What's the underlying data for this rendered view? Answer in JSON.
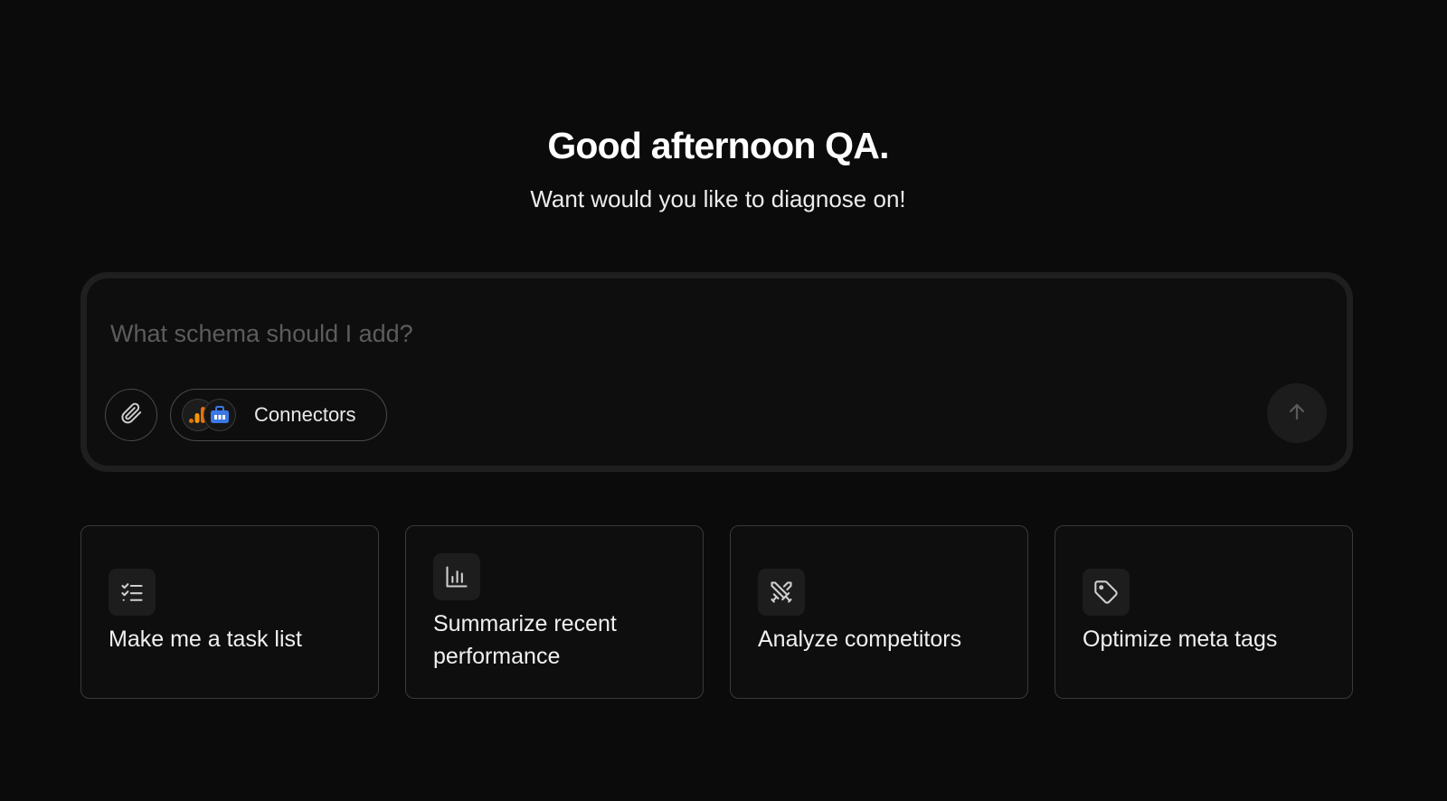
{
  "header": {
    "greeting": "Good afternoon QA.",
    "subtitle": "Want would you like to diagnose on!"
  },
  "composer": {
    "placeholder": "What schema should I add?",
    "value": "",
    "attach_icon": "paperclip-icon",
    "connectors_label": "Connectors",
    "connector_icons": [
      "analytics-chart-icon",
      "briefcase-icon"
    ],
    "send_icon": "arrow-up-icon"
  },
  "cards": [
    {
      "label": "Make me a task list",
      "icon": "checklist-icon"
    },
    {
      "label": "Summarize recent performance",
      "icon": "bar-chart-icon"
    },
    {
      "label": "Analyze competitors",
      "icon": "crossed-swords-icon"
    },
    {
      "label": "Optimize meta tags",
      "icon": "tag-icon"
    }
  ],
  "colors": {
    "background": "#0b0b0b",
    "analytics_orange": "#e8710a",
    "briefcase_blue": "#3b78e7"
  }
}
